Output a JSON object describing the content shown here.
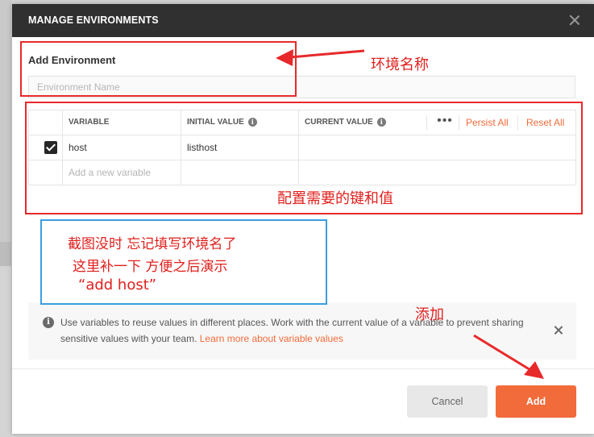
{
  "modal": {
    "title": "MANAGE ENVIRONMENTS",
    "section_label": "Add Environment",
    "env_name_placeholder": "Environment Name"
  },
  "table": {
    "headers": {
      "variable": "VARIABLE",
      "initial_value": "INITIAL VALUE",
      "current_value": "CURRENT VALUE"
    },
    "more_icon": "more-horizontal-icon",
    "persist_all": "Persist All",
    "reset_all": "Reset All",
    "rows": [
      {
        "checked": true,
        "variable": "host",
        "initial_value": "listhost",
        "current_value": ""
      }
    ],
    "new_variable_placeholder": "Add a new variable"
  },
  "info": {
    "text": "Use variables to reuse values in different places. Work with the current value of a variable to prevent sharing sensitive values with your team.",
    "link": "Learn more about variable values"
  },
  "buttons": {
    "cancel": "Cancel",
    "add": "Add"
  },
  "annotations": {
    "env_name_note": "环境名称",
    "kv_note": "配置需要的键和值",
    "blue_note_line1": "截图没时 忘记填写环境名了",
    "blue_note_line2": "这里补一下 方便之后演示",
    "blue_note_line3": "“add host”",
    "add_note": "添加"
  },
  "colors": {
    "accent": "#f26b3a",
    "header_bg": "#303030",
    "annotation_red": "#e8292b",
    "annotation_blue": "#3a9ee0"
  }
}
